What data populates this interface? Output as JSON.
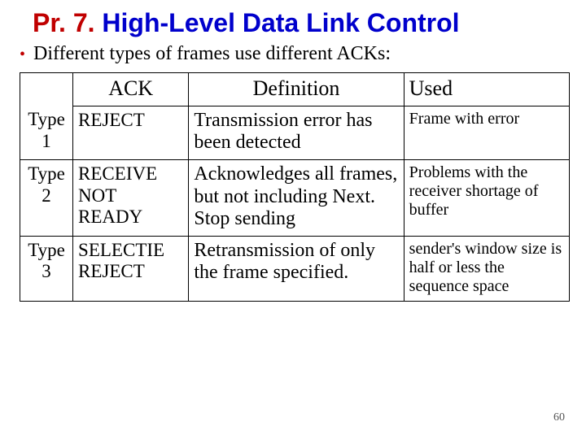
{
  "title": {
    "prefix": "Pr. 7.",
    "rest": " High-Level Data Link Control"
  },
  "bullet": "Different types of frames use different ACKs:",
  "table": {
    "head": {
      "c1": "",
      "c2": "ACK",
      "c3": "Definition",
      "c4": "Used"
    },
    "rows": [
      {
        "c1": "Type 1",
        "c2": "REJECT",
        "c3": "Transmission error has been detected",
        "c4": "Frame with error"
      },
      {
        "c1": "Type 2",
        "c2": "RECEIVE NOT READY",
        "c3": "Acknowledges all frames, but not including Next. Stop sending",
        "c4": "Problems with the receiver shortage of buffer"
      },
      {
        "c1": "Type 3",
        "c2": "SELECTIE REJECT",
        "c3": "Retransmission of only the frame specified.",
        "c4": "sender's window size is half or less the sequence space"
      }
    ]
  },
  "page_number": "60"
}
